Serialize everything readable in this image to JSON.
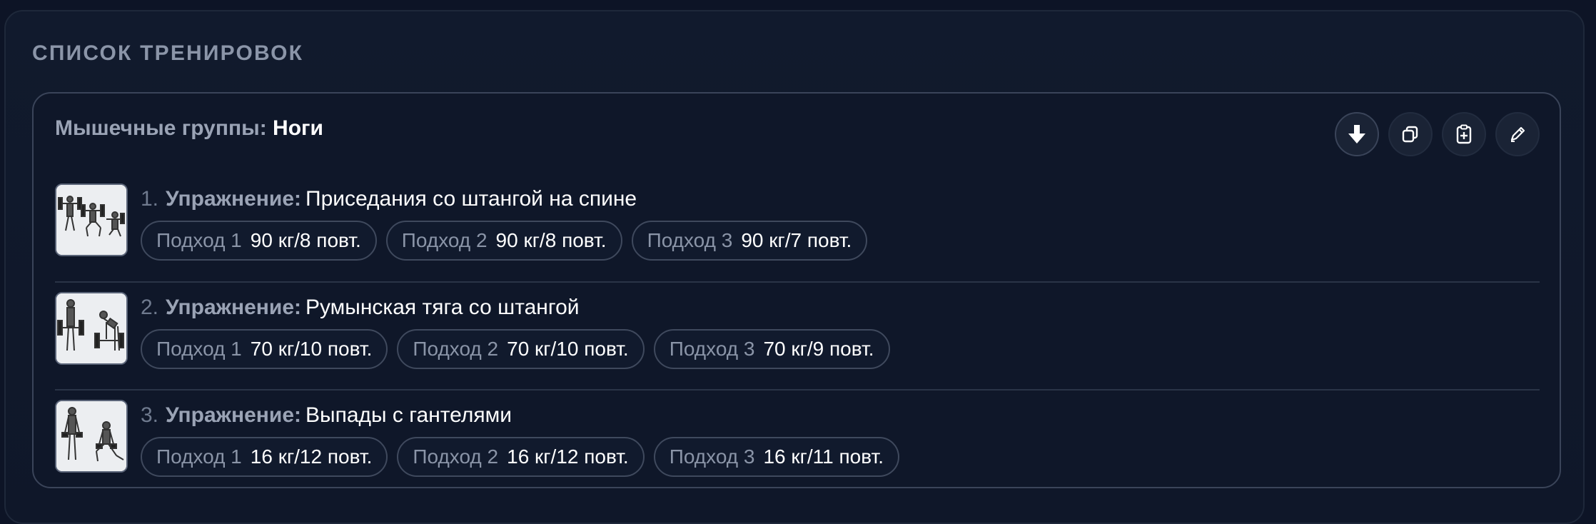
{
  "section": {
    "title": "СПИСОК ТРЕНИРОВОК"
  },
  "workout": {
    "group_label": "Мышечные группы:",
    "group_value": "Ноги",
    "actions": [
      {
        "icon": "download-icon",
        "name": "download-button"
      },
      {
        "icon": "copy-icon",
        "name": "copy-button"
      },
      {
        "icon": "clipboard-add-icon",
        "name": "add-to-clipboard-button"
      },
      {
        "icon": "pencil-icon",
        "name": "edit-button"
      }
    ],
    "exercise_label": "Упражнение:",
    "exercises": [
      {
        "num": "1.",
        "name": "Приседания со штангой на спине",
        "sets": [
          {
            "label": "Подход 1",
            "value": "90 кг/8 повт."
          },
          {
            "label": "Подход 2",
            "value": "90 кг/8 повт."
          },
          {
            "label": "Подход 3",
            "value": "90 кг/7 повт."
          }
        ]
      },
      {
        "num": "2.",
        "name": "Румынская тяга со штангой",
        "sets": [
          {
            "label": "Подход 1",
            "value": "70 кг/10 повт."
          },
          {
            "label": "Подход 2",
            "value": "70 кг/10 повт."
          },
          {
            "label": "Подход 3",
            "value": "70 кг/9 повт."
          }
        ]
      },
      {
        "num": "3.",
        "name": "Выпады с гантелями",
        "sets": [
          {
            "label": "Подход 1",
            "value": "16 кг/12 повт."
          },
          {
            "label": "Подход 2",
            "value": "16 кг/12 повт."
          },
          {
            "label": "Подход 3",
            "value": "16 кг/11 повт."
          }
        ]
      }
    ]
  }
}
